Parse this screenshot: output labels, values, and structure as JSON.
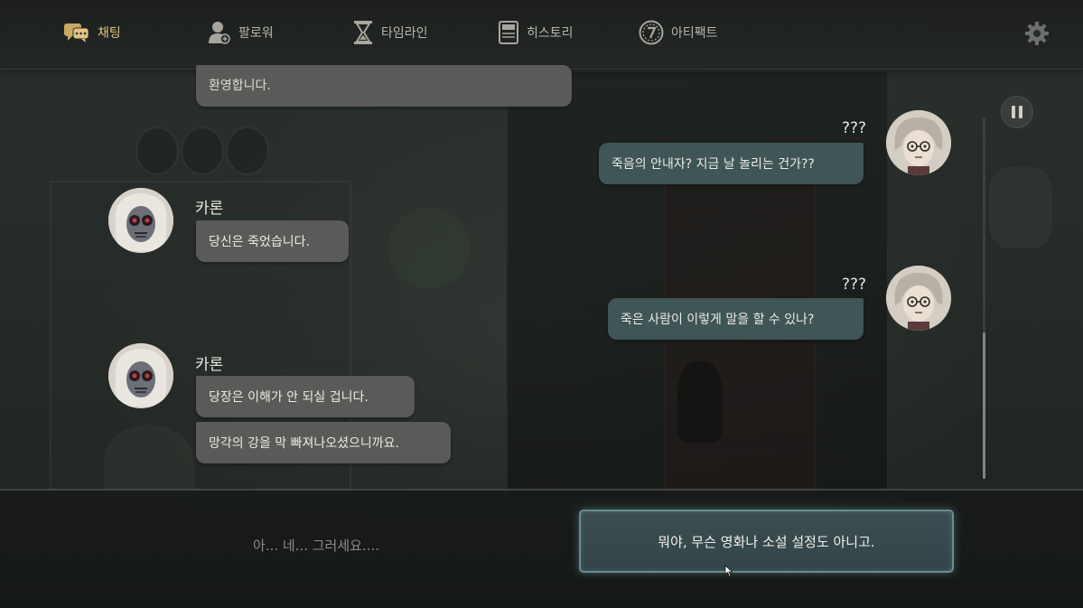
{
  "nav": {
    "tabs": [
      {
        "label": "채팅",
        "icon": "chat-icon",
        "active": true
      },
      {
        "label": "팔로워",
        "icon": "follower-icon",
        "active": false
      },
      {
        "label": "타임라인",
        "icon": "hourglass-icon",
        "active": false
      },
      {
        "label": "히스토리",
        "icon": "book-icon",
        "active": false
      },
      {
        "label": "아티팩트",
        "icon": "artifact-seven-icon",
        "active": false
      }
    ],
    "settings_icon": "gear-icon"
  },
  "chat": {
    "messages": [
      {
        "side": "left",
        "sender": "",
        "text": "환영합니다."
      },
      {
        "side": "left",
        "sender": "카론",
        "text": "당신은 죽었습니다."
      },
      {
        "side": "left",
        "sender": "카론",
        "text": "당장은 이해가 안 되실 겁니다."
      },
      {
        "side": "left",
        "sender": "",
        "text": "망각의 강을 막 빠져나오셨으니까요."
      },
      {
        "side": "right",
        "sender": "???",
        "text": "죽음의 안내자? 지금 날 놀리는 건가??"
      },
      {
        "side": "right",
        "sender": "???",
        "text": "죽은 사람이 이렇게 말을 할 수 있나?"
      }
    ]
  },
  "controls": {
    "pause_icon": "pause-icon"
  },
  "choices": {
    "option_1": "아... 네... 그러세요....",
    "option_2": "뭐야, 무슨 영화나 소설 설정도 아니고."
  },
  "colors": {
    "accent_active_tab": "#e2c483",
    "bubble_left": "#5a5a58",
    "bubble_right": "#3f5556",
    "choice_border": "#6c8b8e"
  }
}
